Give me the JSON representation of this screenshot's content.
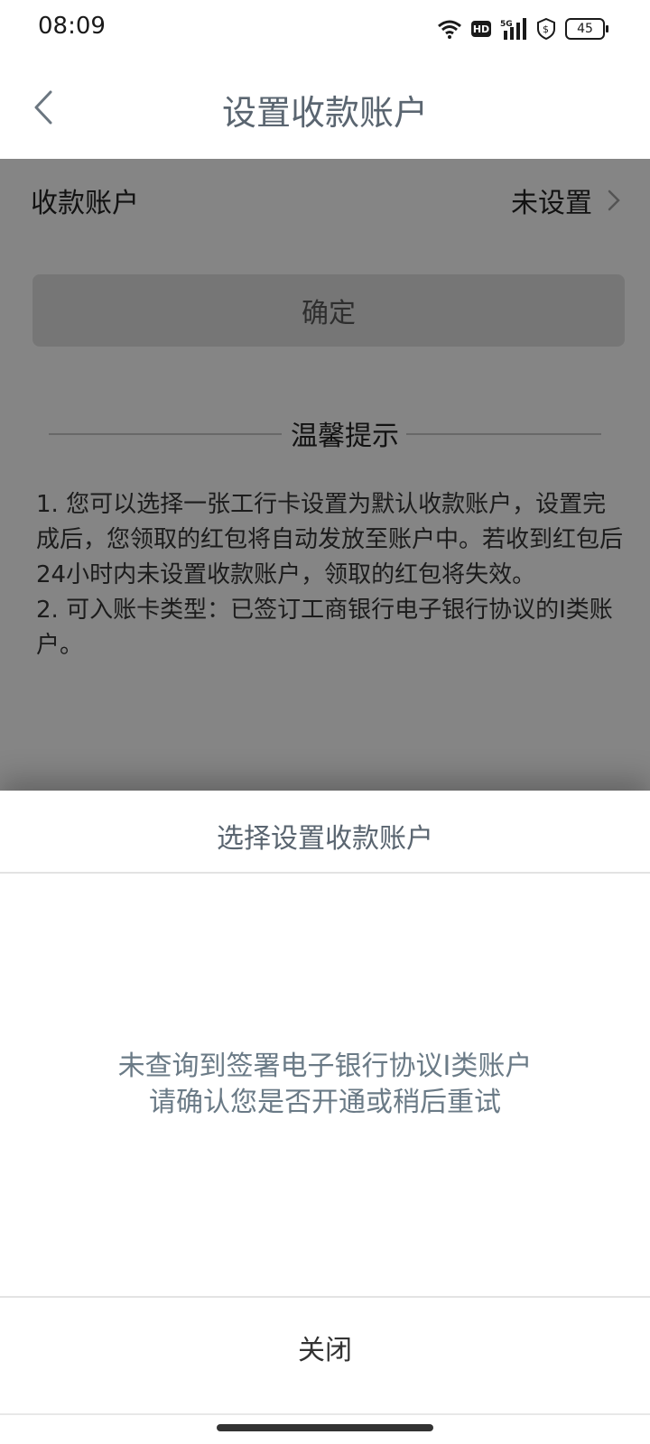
{
  "status_bar": {
    "time": "08:09",
    "hd": "HD",
    "signal_label": "5G",
    "battery": "45"
  },
  "nav": {
    "title": "设置收款账户"
  },
  "account_row": {
    "label": "收款账户",
    "value": "未设置"
  },
  "confirm_button": "确定",
  "tips": {
    "title": "温馨提示",
    "lines": [
      "1. 您可以选择一张工行卡设置为默认收款账户，设置完成后，您领取的红包将自动发放至账户中。若收到红包后24小时内未设置收款账户，领取的红包将失效。",
      "2. 可入账卡类型：已签订工商银行电子银行协议的I类账户。"
    ]
  },
  "sheet": {
    "title": "选择设置收款账户",
    "empty_line1": "未查询到签署电子银行协议I类账户",
    "empty_line2": "请确认您是否开通或稍后重试",
    "close": "关闭"
  },
  "colors": {
    "title_text": "#5a6570",
    "empty_text": "#6a7a86",
    "overlay": "rgba(0,0,0,0.45)"
  }
}
